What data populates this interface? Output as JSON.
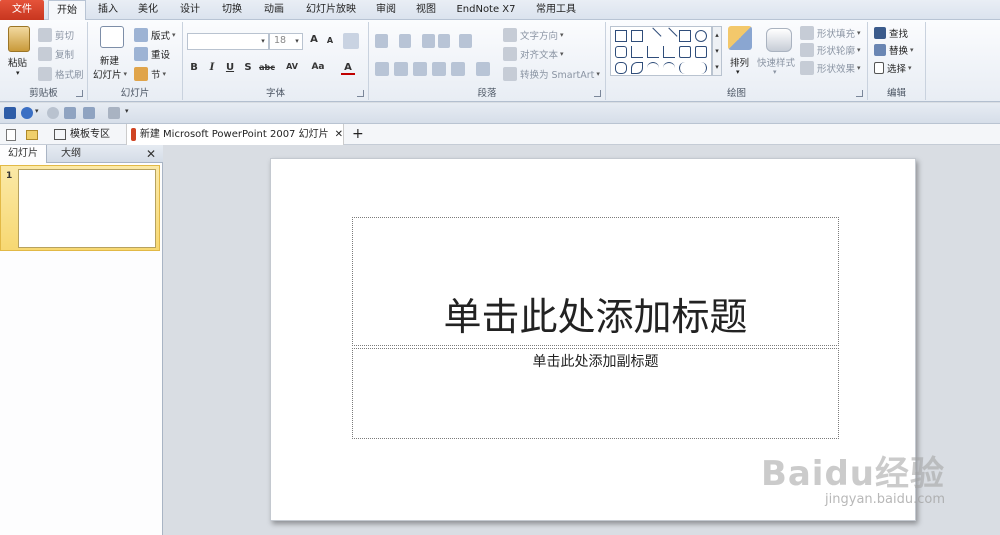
{
  "ribbon_tabs": [
    {
      "label": "文件"
    },
    {
      "label": "开始"
    },
    {
      "label": "插入"
    },
    {
      "label": "美化"
    },
    {
      "label": "设计"
    },
    {
      "label": "切换"
    },
    {
      "label": "动画"
    },
    {
      "label": "幻灯片放映"
    },
    {
      "label": "审阅"
    },
    {
      "label": "视图"
    },
    {
      "label": "EndNote X7"
    },
    {
      "label": "常用工具"
    }
  ],
  "clipboard": {
    "group_label": "剪贴板",
    "paste": "粘贴",
    "cut": "剪切",
    "copy": "复制",
    "format_painter": "格式刷"
  },
  "slides_group": {
    "group_label": "幻灯片",
    "new_slide_line1": "新建",
    "new_slide_line2": "幻灯片",
    "layout": "版式",
    "reset": "重设",
    "section": "节"
  },
  "font_group": {
    "group_label": "字体",
    "font_name": "",
    "font_size": "18",
    "grow": "A",
    "shrink": "A",
    "bold": "B",
    "italic": "I",
    "underline": "U",
    "shadow": "S",
    "strike": "abc",
    "spacing": "AV",
    "case": "Aa",
    "color": "A"
  },
  "paragraph_group": {
    "group_label": "段落",
    "text_direction": "文字方向",
    "align_text": "对齐文本",
    "convert_smartart": "转换为 SmartArt"
  },
  "drawing_group": {
    "group_label": "绘图",
    "arrange": "排列",
    "quick_styles": "快速样式",
    "shape_fill": "形状填充",
    "shape_outline": "形状轮廓",
    "shape_effects": "形状效果"
  },
  "editing_group": {
    "group_label": "编辑",
    "find": "查找",
    "replace": "替换",
    "select": "选择"
  },
  "doc_tabs": {
    "templates": "模板专区",
    "document": "新建 Microsoft PowerPoint 2007 幻灯片",
    "close": "✕",
    "add": "+"
  },
  "pane": {
    "tab_slides": "幻灯片",
    "tab_outline": "大纲",
    "close": "✕",
    "thumb_number": "1"
  },
  "slide": {
    "title_placeholder": "单击此处添加标题",
    "subtitle_placeholder": "单击此处添加副标题"
  },
  "watermark": {
    "logo": "Baidu经验",
    "url": "jingyan.baidu.com"
  },
  "colors": {
    "file_tab": "#d5452c",
    "selection": "#f7d872",
    "ribbon_bg": "#eef2f7"
  }
}
